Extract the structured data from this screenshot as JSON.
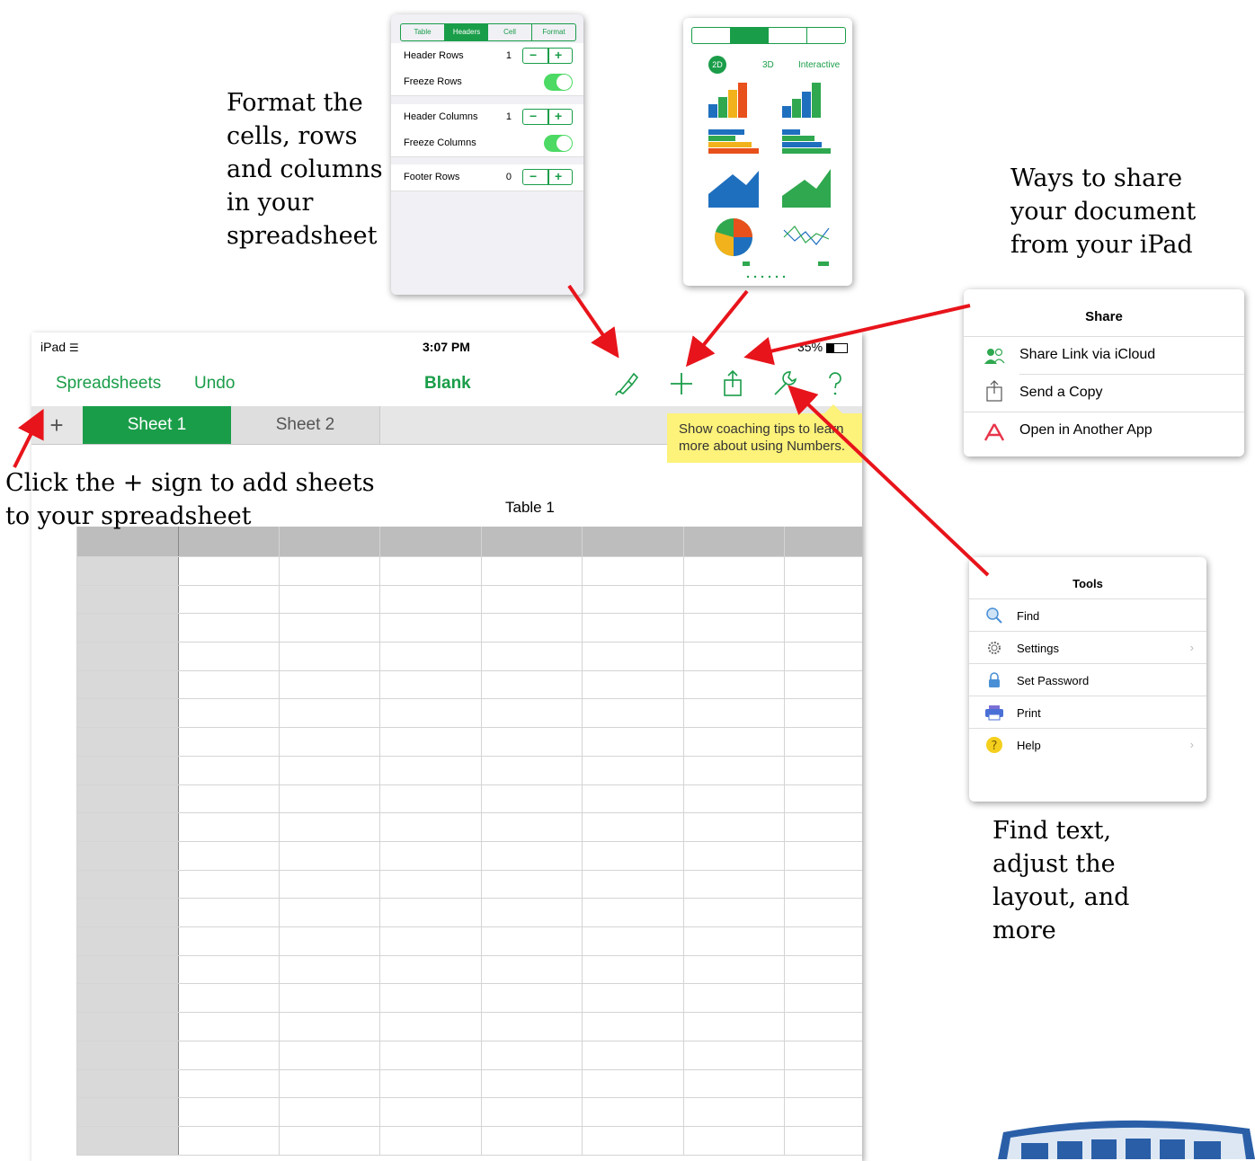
{
  "annotations": {
    "format": [
      "Format the",
      "cells, rows",
      "and columns",
      "in your",
      "spreadsheet"
    ],
    "share": [
      "Ways to share",
      "your document",
      "from your iPad"
    ],
    "add_sheets": [
      "Click the + sign to add sheets",
      "to your spreadsheet"
    ],
    "tools": [
      "Find text,",
      "adjust the",
      "layout, and",
      "more"
    ]
  },
  "status_bar": {
    "device": "iPad",
    "time": "3:07 PM",
    "battery": "35%"
  },
  "nav": {
    "back": "Spreadsheets",
    "undo": "Undo",
    "title": "Blank"
  },
  "toolbar_icons": [
    "paintbrush-icon",
    "plus-icon",
    "share-icon",
    "wrench-icon",
    "question-icon"
  ],
  "tabs": {
    "add": "+",
    "sheets": [
      "Sheet 1",
      "Sheet 2"
    ]
  },
  "tooltip": {
    "line1": "Show coaching tips to learn",
    "line2": "more about using Numbers."
  },
  "table": {
    "title": "Table 1"
  },
  "format_popover": {
    "tabs": [
      "Table",
      "Headers",
      "Cell",
      "Format"
    ],
    "rows": [
      {
        "label": "Header Rows",
        "value": "1"
      },
      {
        "label": "Freeze Rows"
      },
      {
        "label": "Header Columns",
        "value": "1"
      },
      {
        "label": "Freeze Columns"
      },
      {
        "label": "Footer Rows",
        "value": "0"
      }
    ]
  },
  "chart_popover": {
    "modes": [
      "2D",
      "3D",
      "Interactive"
    ]
  },
  "share_popover": {
    "title": "Share",
    "items": [
      "Share Link via iCloud",
      "Send a Copy",
      "Open in Another App"
    ]
  },
  "tools_popover": {
    "title": "Tools",
    "items": [
      "Find",
      "Settings",
      "Set Password",
      "Print",
      "Help"
    ]
  },
  "colors": {
    "accent": "#1a9d49",
    "tooltip": "#fdf27a",
    "arrow": "#e8141b"
  }
}
